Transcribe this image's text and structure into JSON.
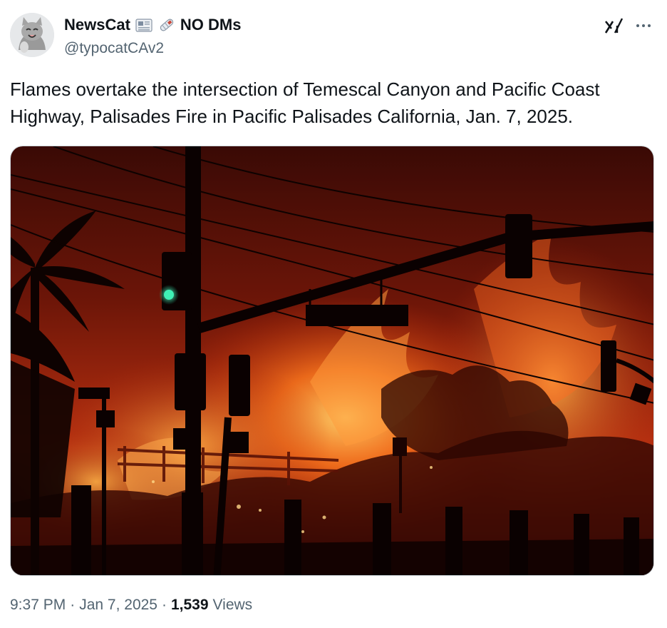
{
  "tweet": {
    "display_name": "NewsCat",
    "name_suffix": "NO DMs",
    "handle": "@typocatCAv2",
    "text": "Flames overtake the intersection of Temescal Canyon and Pacific Coast\nHighway, Palisades Fire in Pacific Palisades California, Jan. 7, 2025.",
    "time": "9:37 PM",
    "date": "Jan 7, 2025",
    "views_count": "1,539",
    "views_label": "Views",
    "separator": "·"
  },
  "icons": {
    "avatar": "cat-avatar",
    "name_emojis": [
      "newspaper-icon",
      "rolled-newspaper-icon"
    ],
    "header_actions": [
      "grok-icon",
      "more-icon"
    ]
  },
  "colors": {
    "text_primary": "#0f1419",
    "text_secondary": "#536471",
    "fire": "#ff5a10",
    "traffic_light": "#1fd39a"
  }
}
